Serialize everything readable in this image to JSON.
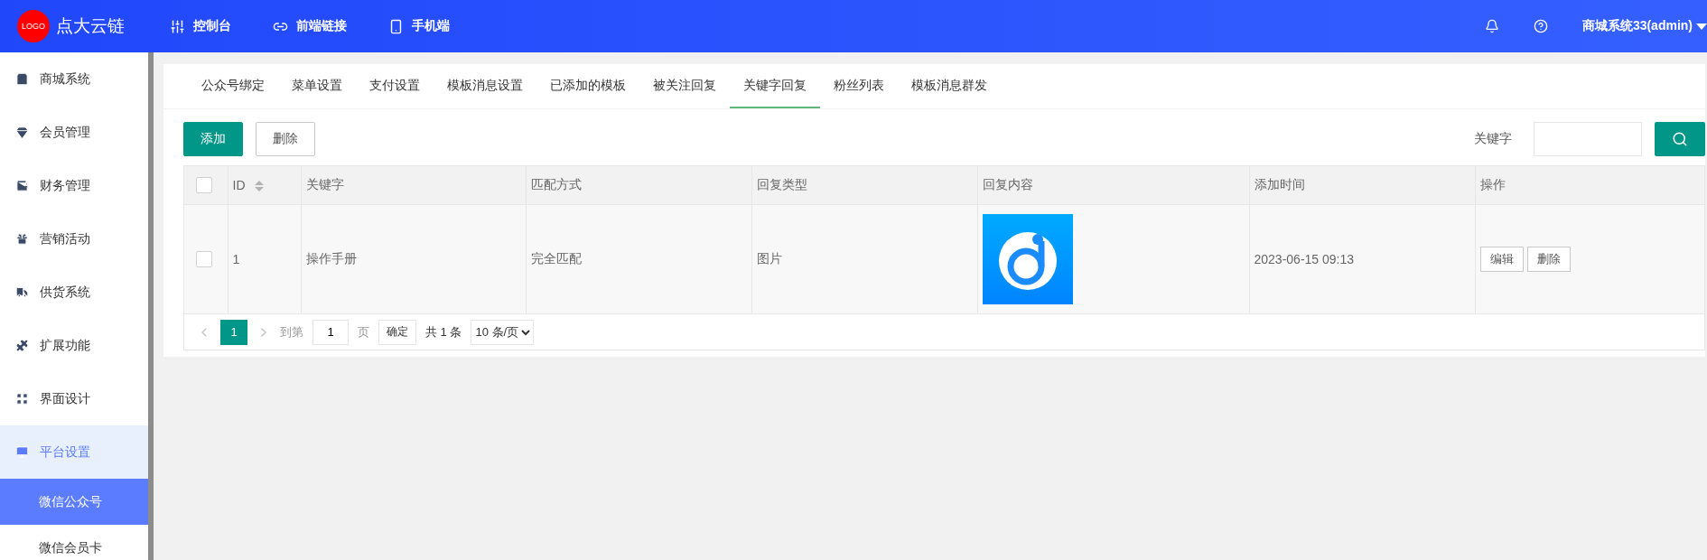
{
  "header": {
    "logo": "LOGO",
    "brand": "点大云链",
    "nav": [
      {
        "label": "控制台"
      },
      {
        "label": "前端链接"
      },
      {
        "label": "手机端"
      }
    ],
    "user": "商城系统33(admin)"
  },
  "sidebar": {
    "items": [
      {
        "label": "商城系统",
        "selected": false
      },
      {
        "label": "会员管理",
        "selected": false
      },
      {
        "label": "财务管理",
        "selected": false
      },
      {
        "label": "营销活动",
        "selected": false
      },
      {
        "label": "供货系统",
        "selected": false
      },
      {
        "label": "扩展功能",
        "selected": false
      },
      {
        "label": "界面设计",
        "selected": false
      },
      {
        "label": "平台设置",
        "selected": true,
        "children": [
          {
            "label": "微信公众号",
            "selected": true
          },
          {
            "label": "微信会员卡",
            "selected": false
          }
        ]
      }
    ]
  },
  "tabs": [
    {
      "label": "公众号绑定",
      "selected": false
    },
    {
      "label": "菜单设置",
      "selected": false
    },
    {
      "label": "支付设置",
      "selected": false
    },
    {
      "label": "模板消息设置",
      "selected": false
    },
    {
      "label": "已添加的模板",
      "selected": false
    },
    {
      "label": "被关注回复",
      "selected": false
    },
    {
      "label": "关键字回复",
      "selected": true
    },
    {
      "label": "粉丝列表",
      "selected": false
    },
    {
      "label": "模板消息群发",
      "selected": false
    }
  ],
  "toolbar": {
    "buttons": [
      {
        "label": "添加",
        "kind": "primary"
      },
      {
        "label": "删除",
        "kind": "plain"
      }
    ],
    "search_label": "关键字"
  },
  "table": {
    "columns": [
      "ID",
      "关键字",
      "匹配方式",
      "回复类型",
      "回复内容",
      "添加时间",
      "操作"
    ],
    "rows": [
      {
        "checked": false,
        "id": "1",
        "keyword": "操作手册",
        "match": "完全匹配",
        "reply_type": "图片",
        "added": "2023-06-15 09:13",
        "actions": [
          "编辑",
          "删除"
        ]
      }
    ],
    "header_checked": false
  },
  "pagination": {
    "pages": [
      {
        "label": "1",
        "selected": true
      }
    ],
    "goto_label": "到第",
    "goto_value": "1",
    "page_unit": "页",
    "confirm": "确定",
    "total": "共 1 条",
    "page_size": "10 条/页"
  }
}
